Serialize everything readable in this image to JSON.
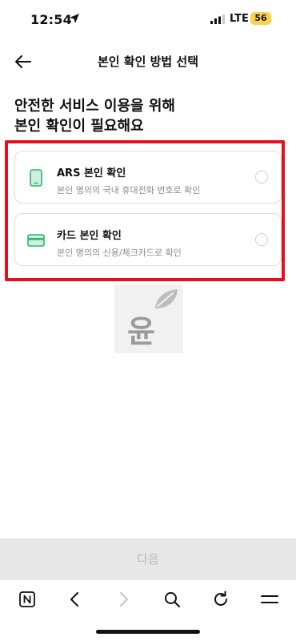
{
  "status_bar": {
    "time": "12:54",
    "network": "LTE",
    "battery": "56"
  },
  "header": {
    "title": "본인 확인 방법 선택"
  },
  "headline": {
    "line1": "안전한 서비스 이용을 위해",
    "line2": "본인 확인이 필요해요"
  },
  "options": [
    {
      "title": "ARS 본인 확인",
      "description": "본인 명의의 국내 휴대전화 번호로 확인",
      "icon": "phone-icon",
      "selected": false
    },
    {
      "title": "카드 본인 확인",
      "description": "본인 명의의 신용/체크카드로 확인",
      "icon": "card-icon",
      "selected": false
    }
  ],
  "watermark": {
    "text": "윤"
  },
  "footer": {
    "next_label": "다음"
  },
  "colors": {
    "highlight": "#e4101b",
    "icon_green": "#2fb36b",
    "disabled_button": "#e7e7e7",
    "battery": "#f7d24a"
  },
  "browser_toolbar": [
    "naver-icon",
    "back-icon",
    "forward-icon",
    "search-icon",
    "refresh-icon",
    "menu-icon"
  ]
}
